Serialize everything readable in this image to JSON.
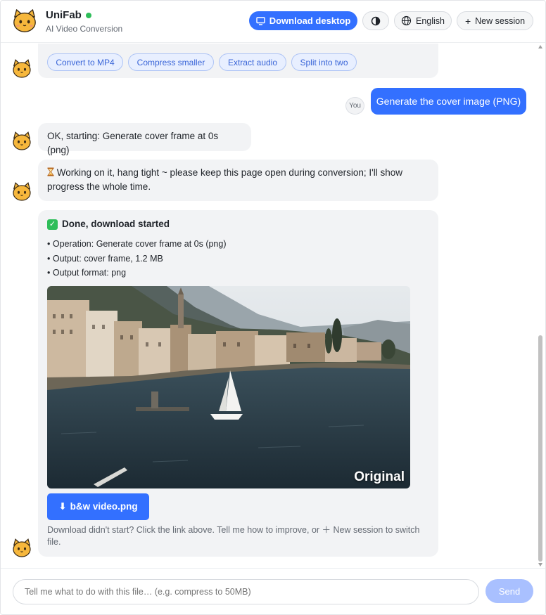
{
  "header": {
    "app_name": "UniFab",
    "app_subtitle": "AI Video Conversion",
    "download_desktop": "Download desktop",
    "language": "English",
    "new_session": "New session",
    "online_color": "#2ebd59",
    "accent_color": "#3370ff"
  },
  "chat": {
    "partial_message": {
      "chips": [
        "Convert to MP4",
        "Compress smaller",
        "Extract audio",
        "Split into two"
      ]
    },
    "user_message": {
      "badge": "You",
      "text": "Generate the cover image (PNG)"
    },
    "bot_start": "OK, starting: Generate cover frame at 0s (png)",
    "bot_working": "Working on it, hang tight ~ please keep this page open during conversion; I'll show progress the whole time.",
    "bot_done": {
      "title": "Done, download started",
      "lines": [
        "• Operation: Generate cover frame at 0s (png)",
        "• Output: cover frame, 1.2 MB",
        "• Output format: png"
      ],
      "preview_label": "Original",
      "file_button": "b&w video.png",
      "hint": "Download didn't start? Click the link above. Tell me how to improve, or ＋ New session to switch file."
    }
  },
  "composer": {
    "placeholder": "Tell me what to do with this file… (e.g. compress to 50MB)",
    "send": "Send"
  },
  "icons": {
    "logo": "cat-logo-icon",
    "download": "monitor-icon",
    "theme": "contrast-icon",
    "language": "globe-icon",
    "new": "plus-icon",
    "working": "hourglass-icon",
    "done": "check-box-icon",
    "file": "download-arrow-icon"
  }
}
